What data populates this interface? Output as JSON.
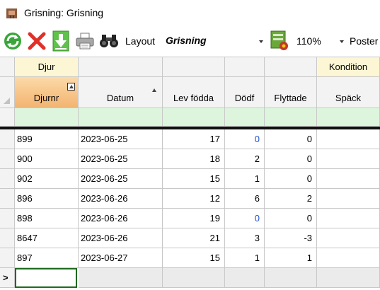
{
  "window": {
    "title": "Grisning: Grisning"
  },
  "toolbar": {
    "buttons": [
      {
        "name": "refresh-button",
        "icon": "refresh-icon"
      },
      {
        "name": "delete-button",
        "icon": "delete-x-icon"
      },
      {
        "name": "download-button",
        "icon": "download-arrow-icon"
      },
      {
        "name": "print-button",
        "icon": "printer-icon"
      },
      {
        "name": "binoculars-button",
        "icon": "binoculars-icon"
      }
    ],
    "layout_label": "Layout",
    "layout_value": "Grisning",
    "layout_settings_icon": "layout-settings-icon",
    "zoom_value": "110%",
    "poster_label": "Poster"
  },
  "grid": {
    "groups": {
      "djur": "Djur",
      "kondition": "Kondition"
    },
    "columns": [
      {
        "key": "djurnr",
        "label": "Djurnr"
      },
      {
        "key": "datum",
        "label": "Datum"
      },
      {
        "key": "lev_fodda",
        "label": "Lev födda"
      },
      {
        "key": "dodf",
        "label": "Dödf"
      },
      {
        "key": "flyttade",
        "label": "Flyttade"
      },
      {
        "key": "spack",
        "label": "Späck"
      }
    ],
    "rows": [
      {
        "djurnr": "899",
        "datum": "2023-06-25",
        "lev_fodda": "17",
        "dodf": "0",
        "flyttade": "0",
        "spack": ""
      },
      {
        "djurnr": "900",
        "datum": "2023-06-25",
        "lev_fodda": "18",
        "dodf": "2",
        "flyttade": "0",
        "spack": ""
      },
      {
        "djurnr": "902",
        "datum": "2023-06-25",
        "lev_fodda": "15",
        "dodf": "1",
        "flyttade": "0",
        "spack": ""
      },
      {
        "djurnr": "896",
        "datum": "2023-06-26",
        "lev_fodda": "12",
        "dodf": "6",
        "flyttade": "2",
        "spack": ""
      },
      {
        "djurnr": "898",
        "datum": "2023-06-26",
        "lev_fodda": "19",
        "dodf": "0",
        "flyttade": "0",
        "spack": ""
      },
      {
        "djurnr": "8647",
        "datum": "2023-06-26",
        "lev_fodda": "21",
        "dodf": "3",
        "flyttade": "-3",
        "spack": ""
      },
      {
        "djurnr": "897",
        "datum": "2023-06-27",
        "lev_fodda": "15",
        "dodf": "1",
        "flyttade": "1",
        "spack": ""
      }
    ],
    "new_row_marker": ">",
    "colors": {
      "sorted_header": "#f7c88f",
      "filter_row": "#ddf5dd",
      "zero_value_blue": "#1f4fd0",
      "active_cell_border": "#1f6b1f"
    }
  }
}
